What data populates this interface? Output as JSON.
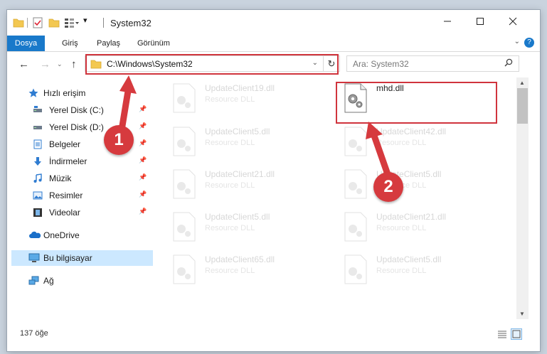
{
  "title": "System32",
  "ribbon": {
    "tabs": [
      "Dosya",
      "Giriş",
      "Paylaş",
      "Görünüm"
    ]
  },
  "address": {
    "path": "C:\\Windows\\System32"
  },
  "search": {
    "placeholder": "Ara: System32"
  },
  "sidebar": {
    "quick_access": "Hızlı erişim",
    "items": [
      {
        "label": "Yerel Disk (C:)"
      },
      {
        "label": "Yerel Disk (D:)"
      },
      {
        "label": "Belgeler"
      },
      {
        "label": "İndirmeler"
      },
      {
        "label": "Müzik"
      },
      {
        "label": "Resimler"
      },
      {
        "label": "Videolar"
      }
    ],
    "onedrive": "OneDrive",
    "this_pc": "Bu bilgisayar",
    "network": "Ağ"
  },
  "files": [
    {
      "name": "UpdateClient19.dll",
      "type": "Resource DLL"
    },
    {
      "name": "mhd.dll",
      "type": ""
    },
    {
      "name": "UpdateClient5.dll",
      "type": "Resource DLL"
    },
    {
      "name": "UpdateClient42.dll",
      "type": "Resource DLL"
    },
    {
      "name": "UpdateClient21.dll",
      "type": "Resource DLL"
    },
    {
      "name": "UpdateClient5.dll",
      "type": "Resource DLL"
    },
    {
      "name": "UpdateClient5.dll",
      "type": "Resource DLL"
    },
    {
      "name": "UpdateClient21.dll",
      "type": "Resource DLL"
    },
    {
      "name": "UpdateClient65.dll",
      "type": "Resource DLL"
    },
    {
      "name": "UpdateClient5.dll",
      "type": "Resource DLL"
    }
  ],
  "status": {
    "count": "137 öğe"
  },
  "annotations": {
    "step1": "1",
    "step2": "2",
    "color": "#d0343d"
  }
}
